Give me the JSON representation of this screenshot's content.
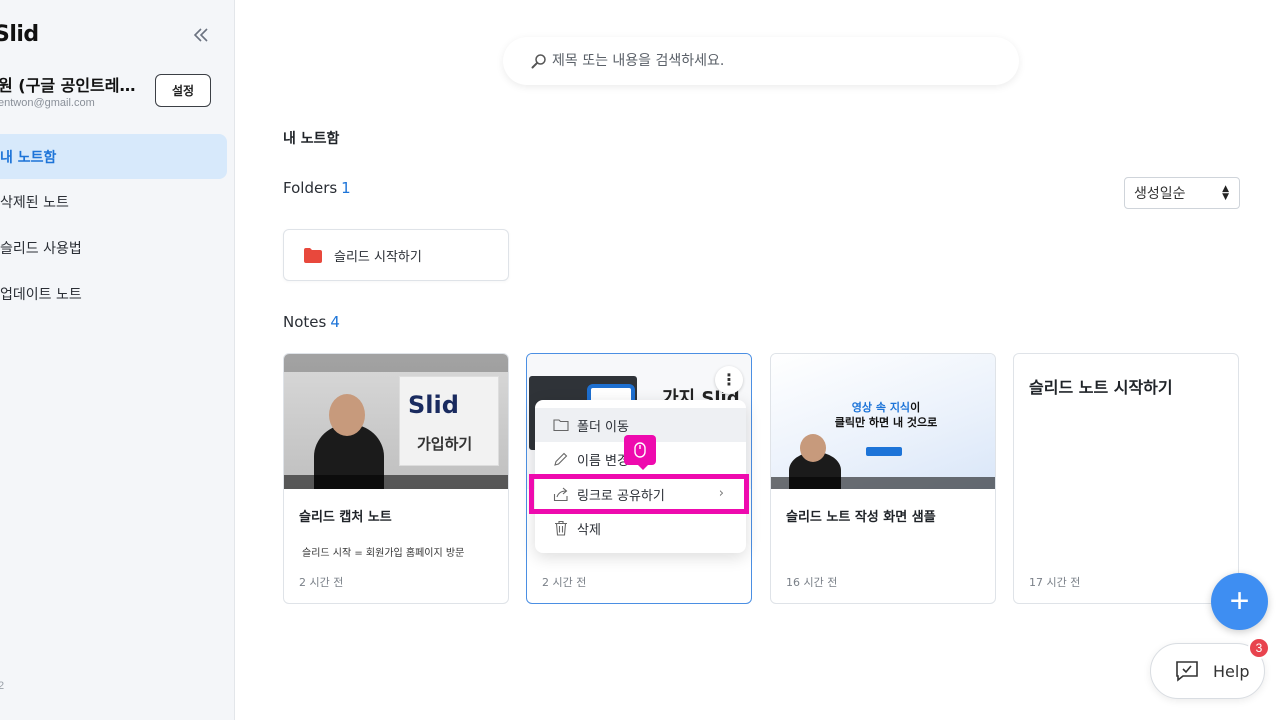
{
  "sidebar": {
    "logo": "Slid",
    "profile_name": "원 (구글 공인트레…",
    "profile_email": "entwon@gmail.com",
    "settings_label": "설정",
    "items": [
      {
        "label": "내 노트함",
        "active": true
      },
      {
        "label": "삭제된 노트"
      },
      {
        "label": "슬리드 사용법"
      },
      {
        "label": "업데이트 노트"
      }
    ],
    "footer": "2"
  },
  "search": {
    "placeholder": "제목 또는 내용을 검색하세요."
  },
  "main": {
    "title": "내 노트함",
    "folders_label": "Folders",
    "folders_count": "1",
    "sort": {
      "selected": "생성일순"
    },
    "folders": [
      {
        "label": "슬리드 시작하기",
        "icon": "folder-icon",
        "color": "#e8483c"
      }
    ],
    "notes_label": "Notes",
    "notes_count": "4",
    "notes": [
      {
        "title": "슬리드 캡처 노트",
        "body": "슬리드 시작 = 회원가입 홈페이지 방문",
        "time": "2 시간 전",
        "thumb_text": "Slid",
        "thumb_sub": "가입하기"
      },
      {
        "title": "",
        "body": "",
        "time": "2 시간 전",
        "thumb_text": "가지 Slid"
      },
      {
        "title": "슬리드 노트 작성 화면 샘플",
        "body": "",
        "time": "16 시간 전",
        "thumb_headline_blue": "영상 속 지식",
        "thumb_headline_rest": "이",
        "thumb_headline_line2": "클릭만 하면 내 것으로"
      },
      {
        "title": "슬리드 노트 시작하기",
        "body": "",
        "time": "17 시간 전"
      }
    ]
  },
  "context_menu": {
    "items": [
      {
        "label": "폴더 이동",
        "icon": "folder-outline-icon"
      },
      {
        "label": "이름 변경",
        "icon": "pencil-icon"
      },
      {
        "label": "링크로 공유하기",
        "icon": "share-icon"
      },
      {
        "label": "삭제",
        "icon": "trash-icon"
      }
    ]
  },
  "fab": {
    "label": "+"
  },
  "help": {
    "label": "Help",
    "badge": "3"
  },
  "colors": {
    "accent": "#1d74d8",
    "highlight": "#ee0aae",
    "fab": "#3e8ef2",
    "badge": "#e8434e"
  }
}
